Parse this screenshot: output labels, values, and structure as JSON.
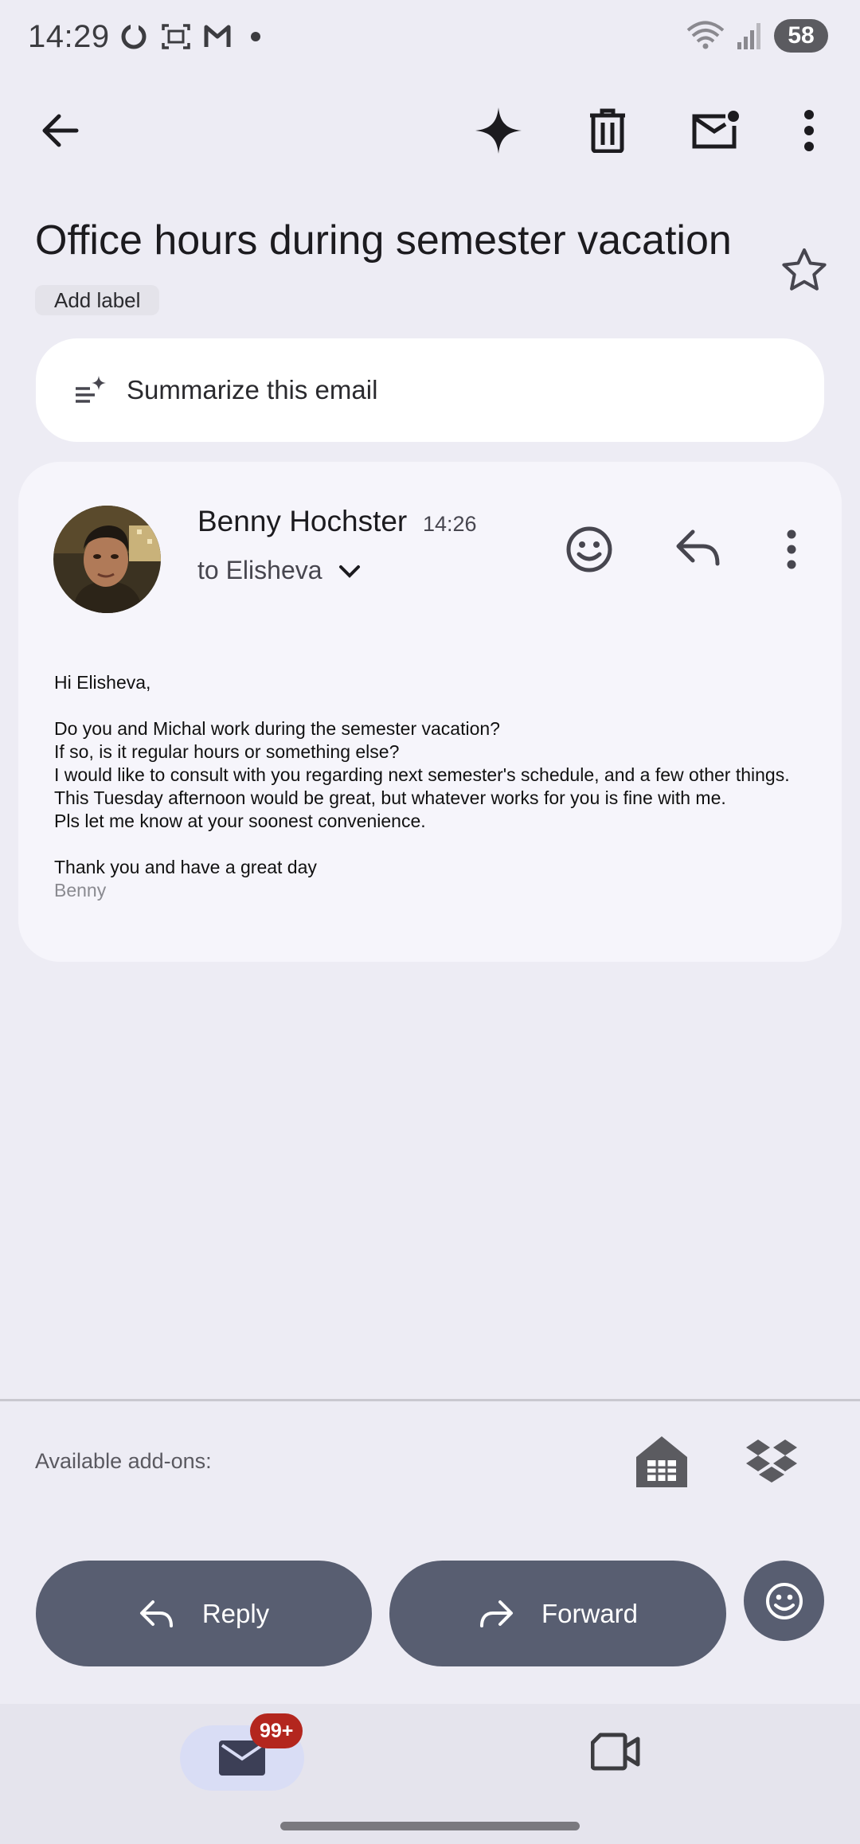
{
  "status_bar": {
    "time": "14:29",
    "battery": "58",
    "icons": [
      "sync-icon",
      "screenshot-icon",
      "gmail-icon",
      "dot-icon",
      "wifi-icon",
      "signal-icon"
    ]
  },
  "app_bar": {
    "icons": [
      "back-arrow-icon",
      "gemini-sparkle-icon",
      "delete-icon",
      "mark-unread-icon",
      "more-vert-icon"
    ]
  },
  "email": {
    "subject": "Office hours during semester vacation",
    "label_chip": "Add label",
    "summarize": "Summarize this email",
    "sender": "Benny Hochster",
    "time": "14:26",
    "recipient": "to Elisheva",
    "body": {
      "greeting": "Hi Elisheva,",
      "lines": [
        "Do you and Michal work during the semester vacation?",
        "If so, is it regular hours or something else?",
        "I would like to consult with you regarding next semester's schedule, and a few other things. This Tuesday afternoon would be great, but whatever works for you is fine with me.",
        "Pls let me know at your soonest convenience."
      ],
      "closing": "Thank you and have a great day",
      "signature": "Benny"
    }
  },
  "addons": {
    "label": "Available add-ons:"
  },
  "actions": {
    "reply": "Reply",
    "forward": "Forward"
  },
  "bottom_nav": {
    "mail_badge": "99+"
  },
  "colors": {
    "background": "#edecf4",
    "card": "#f6f5fb",
    "action_button": "#585e71",
    "badge": "#b3261e",
    "nav_active": "#d9ddf5"
  }
}
